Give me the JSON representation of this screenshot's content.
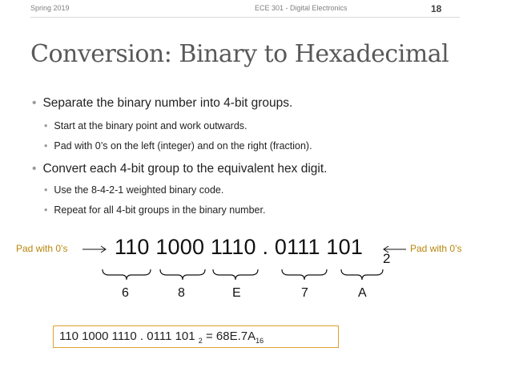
{
  "header": {
    "left": "Spring 2019",
    "center": "ECE 301 - Digital Electronics",
    "slide_number": "18"
  },
  "title": "Conversion:  Binary to Hexadecimal",
  "bullets": [
    {
      "text": "Separate the binary number into 4-bit groups.",
      "sub": [
        "Start at the binary point and work outwards.",
        "Pad with 0’s on the left (integer) and on the right (fraction)."
      ]
    },
    {
      "text": "Convert each 4-bit group to the equivalent hex digit.",
      "sub": [
        "Use the 8-4-2-1 weighted binary code.",
        "Repeat for all 4-bit groups in the binary number."
      ]
    }
  ],
  "bullet_glyph": "•",
  "diagram": {
    "pad_left_label": "Pad with 0’s",
    "pad_right_label": "Pad with 0’s",
    "binary_number": "110 1000 1110 . 0111 101",
    "base": "2",
    "hex_digits": [
      "6",
      "8",
      "E",
      "7",
      "A"
    ],
    "accent_color": "#b8860b",
    "box_color": "#e0a030"
  },
  "result": {
    "binary": "110 1000 1110 . 0111 101",
    "binary_base": "2",
    "equals": "=",
    "hex": "68E.7A",
    "hex_base": "16"
  }
}
